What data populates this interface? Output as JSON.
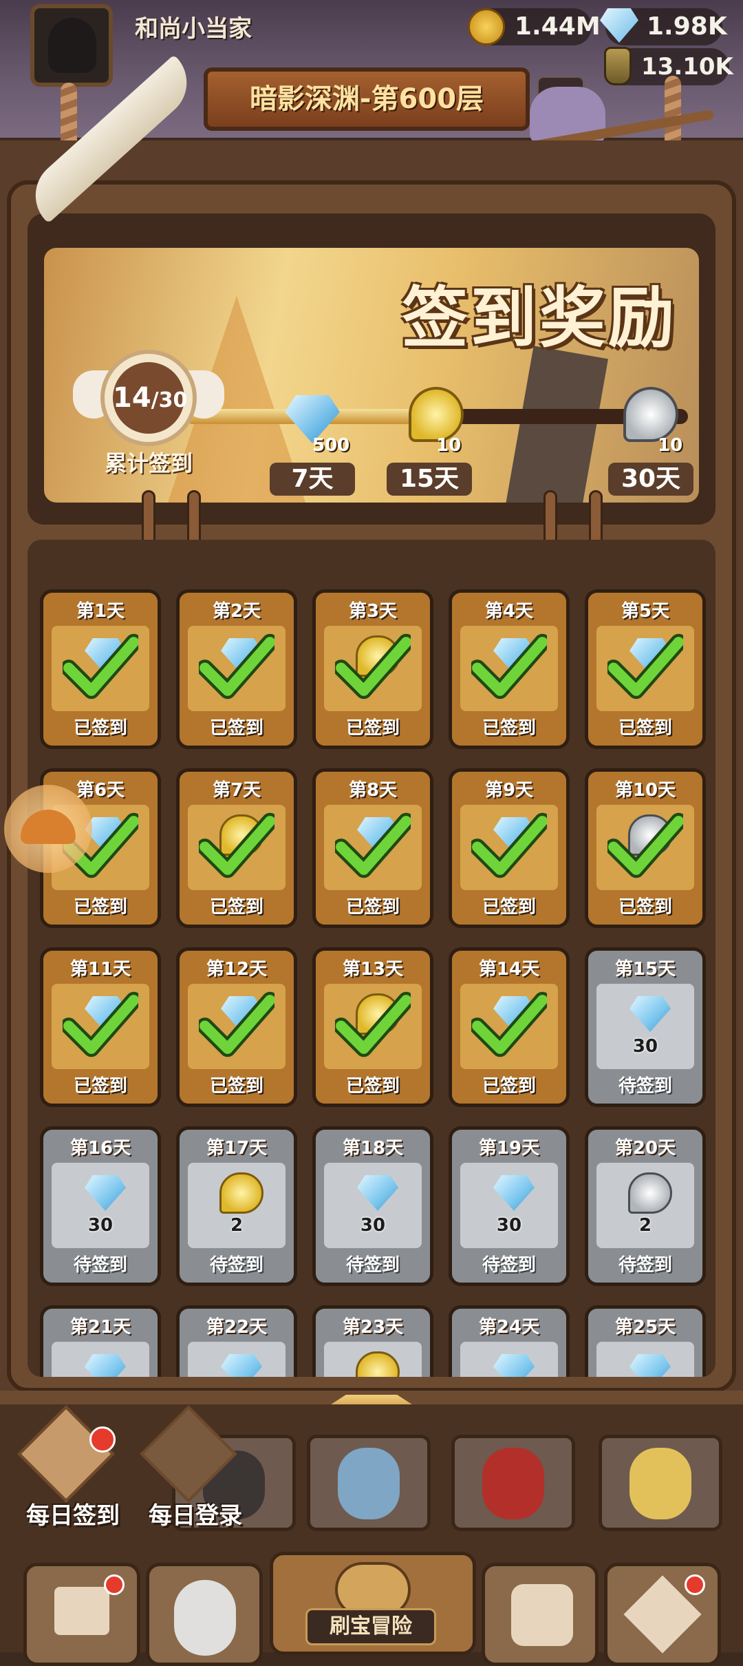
{
  "player": {
    "name": "和尚小当家"
  },
  "resources": {
    "gold": "1.44M",
    "gems": "1.98K",
    "potion": "13.10K"
  },
  "stage": {
    "title": "暗影深渊-第600层"
  },
  "banner": {
    "title": "签到奖励",
    "progress": {
      "current": "14",
      "total": "30",
      "label": "累计签到",
      "fraction": 0.4667
    },
    "milestones": [
      {
        "amount": "500",
        "day": "7天",
        "item": "gem-icon"
      },
      {
        "amount": "10",
        "day": "15天",
        "item": "gold-scroll-icon"
      },
      {
        "amount": "10",
        "day": "30天",
        "item": "silver-scroll-icon"
      }
    ]
  },
  "days": [
    {
      "day": "第1天",
      "status": "已签到",
      "signed": true,
      "item": "gem"
    },
    {
      "day": "第2天",
      "status": "已签到",
      "signed": true,
      "item": "gem"
    },
    {
      "day": "第3天",
      "status": "已签到",
      "signed": true,
      "item": "gold"
    },
    {
      "day": "第4天",
      "status": "已签到",
      "signed": true,
      "item": "gem"
    },
    {
      "day": "第5天",
      "status": "已签到",
      "signed": true,
      "item": "gem"
    },
    {
      "day": "第6天",
      "status": "已签到",
      "signed": true,
      "item": "gem"
    },
    {
      "day": "第7天",
      "status": "已签到",
      "signed": true,
      "item": "gold"
    },
    {
      "day": "第8天",
      "status": "已签到",
      "signed": true,
      "item": "gem"
    },
    {
      "day": "第9天",
      "status": "已签到",
      "signed": true,
      "item": "gem"
    },
    {
      "day": "第10天",
      "status": "已签到",
      "signed": true,
      "item": "silver"
    },
    {
      "day": "第11天",
      "status": "已签到",
      "signed": true,
      "item": "gem"
    },
    {
      "day": "第12天",
      "status": "已签到",
      "signed": true,
      "item": "gem"
    },
    {
      "day": "第13天",
      "status": "已签到",
      "signed": true,
      "item": "gold"
    },
    {
      "day": "第14天",
      "status": "已签到",
      "signed": true,
      "item": "gem"
    },
    {
      "day": "第15天",
      "status": "待签到",
      "signed": false,
      "item": "gem",
      "amount": "30"
    },
    {
      "day": "第16天",
      "status": "待签到",
      "signed": false,
      "item": "gem",
      "amount": "30"
    },
    {
      "day": "第17天",
      "status": "待签到",
      "signed": false,
      "item": "gold",
      "amount": "2"
    },
    {
      "day": "第18天",
      "status": "待签到",
      "signed": false,
      "item": "gem",
      "amount": "30"
    },
    {
      "day": "第19天",
      "status": "待签到",
      "signed": false,
      "item": "gem",
      "amount": "30"
    },
    {
      "day": "第20天",
      "status": "待签到",
      "signed": false,
      "item": "silver",
      "amount": "2"
    },
    {
      "day": "第21天",
      "status": "",
      "signed": false,
      "item": "gem"
    },
    {
      "day": "第22天",
      "status": "",
      "signed": false,
      "item": "gem"
    },
    {
      "day": "第23天",
      "status": "",
      "signed": false,
      "item": "gold"
    },
    {
      "day": "第24天",
      "status": "",
      "signed": false,
      "item": "gem"
    },
    {
      "day": "第25天",
      "status": "",
      "signed": false,
      "item": "gem"
    }
  ],
  "quick": {
    "daily_checkin": "每日签到",
    "daily_login": "每日登录"
  },
  "nav": {
    "adventure": "刷宝冒险"
  },
  "colors": {
    "gem": "#7cc7ef",
    "gold": "#e8c43a",
    "silver": "#b9bdc2",
    "check": "#6fd43a",
    "badge": "#e53b2c"
  }
}
